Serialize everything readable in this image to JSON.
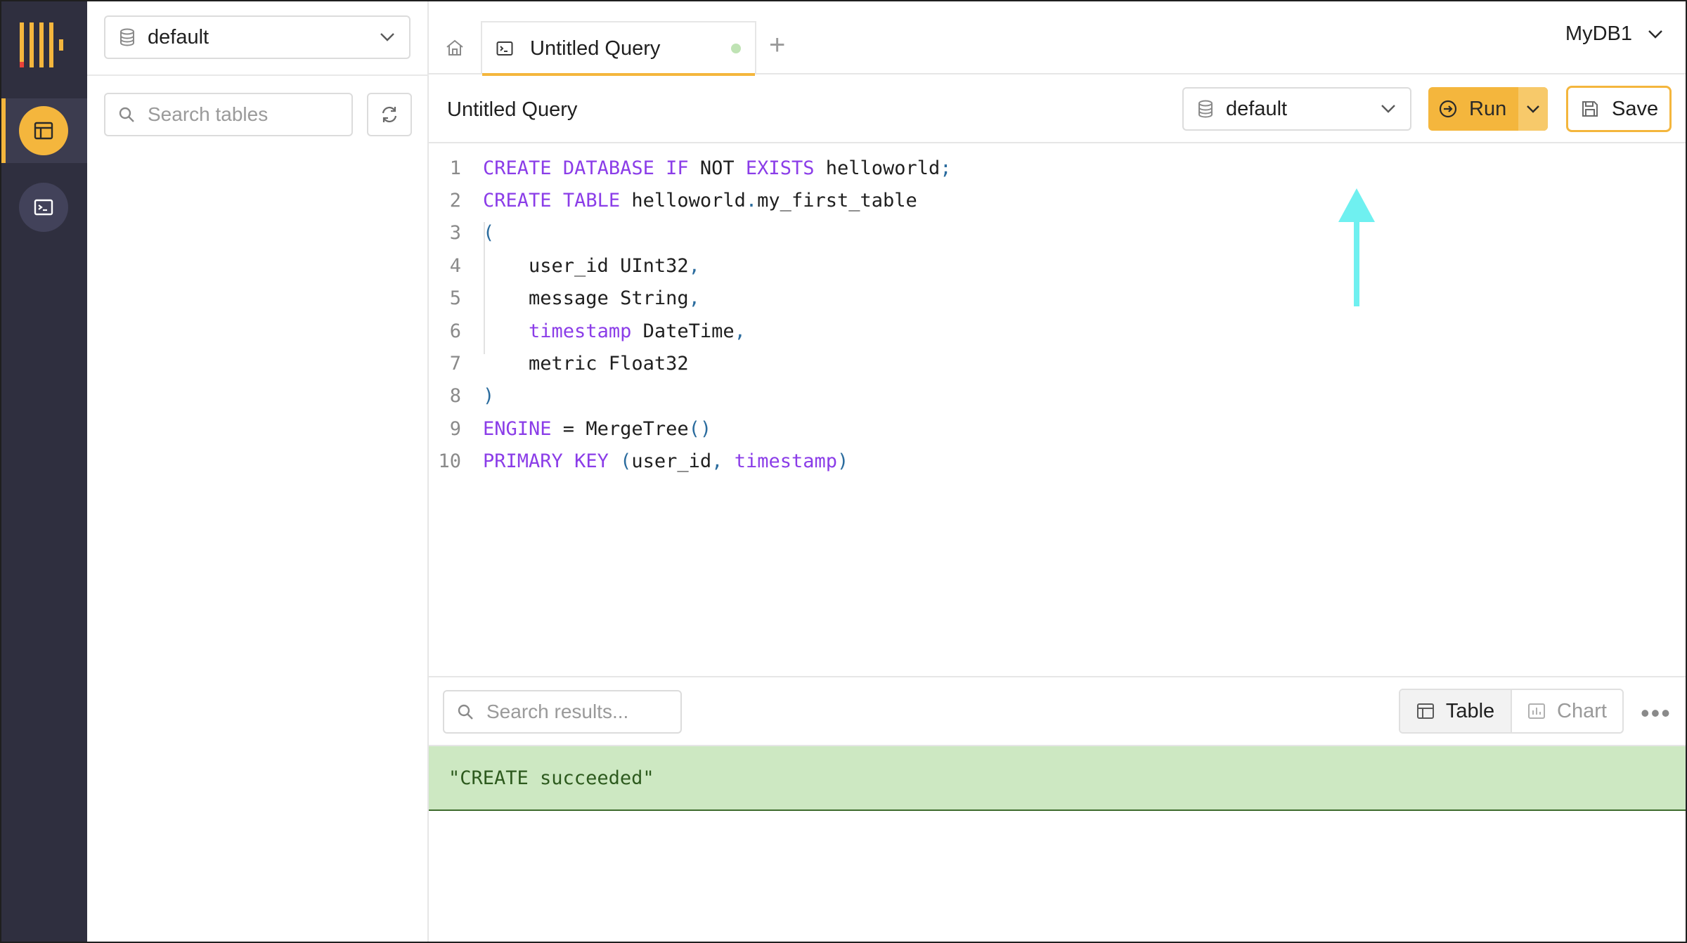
{
  "colors": {
    "nav_bg": "#2f2f3f",
    "accent": "#f4b63d",
    "keyword": "#8b3de8",
    "punct": "#2b6c9e",
    "success_bg": "#cde8c2",
    "success_text": "#2d5a1e",
    "arrow": "#6ff0f0"
  },
  "nav": {
    "logo_icon": "clickhouse-logo",
    "items": [
      {
        "name": "tables",
        "icon": "table-icon",
        "active": true
      },
      {
        "name": "queries",
        "icon": "terminal-icon",
        "active": false
      }
    ]
  },
  "sidebar": {
    "database": "default",
    "search_placeholder": "Search tables",
    "refresh_icon": "refresh-icon"
  },
  "tabs": {
    "home_icon": "home-icon",
    "items": [
      {
        "label": "Untitled Query",
        "icon": "terminal-icon",
        "unsaved": true
      }
    ],
    "add_label": "+",
    "service_name": "MyDB1"
  },
  "toolbar": {
    "query_title": "Untitled Query",
    "database": "default",
    "run_label": "Run",
    "save_label": "Save"
  },
  "editor": {
    "lines": [
      {
        "n": "1",
        "tokens": [
          [
            "kw",
            "CREATE"
          ],
          [
            "t",
            " "
          ],
          [
            "kw",
            "DATABASE"
          ],
          [
            "t",
            " "
          ],
          [
            "kw",
            "IF"
          ],
          [
            "t",
            " NOT "
          ],
          [
            "kw",
            "EXISTS"
          ],
          [
            "t",
            " helloworld"
          ],
          [
            "pn",
            ";"
          ]
        ]
      },
      {
        "n": "2",
        "tokens": [
          [
            "kw",
            "CREATE"
          ],
          [
            "t",
            " "
          ],
          [
            "kw",
            "TABLE"
          ],
          [
            "t",
            " helloworld"
          ],
          [
            "pn",
            "."
          ],
          [
            "t",
            "my_first_table"
          ]
        ]
      },
      {
        "n": "3",
        "tokens": [
          [
            "pn",
            "("
          ]
        ]
      },
      {
        "n": "4",
        "tokens": [
          [
            "t",
            "    user_id UInt32"
          ],
          [
            "pn",
            ","
          ]
        ]
      },
      {
        "n": "5",
        "tokens": [
          [
            "t",
            "    message String"
          ],
          [
            "pn",
            ","
          ]
        ]
      },
      {
        "n": "6",
        "tokens": [
          [
            "t",
            "    "
          ],
          [
            "kw",
            "timestamp"
          ],
          [
            "t",
            " DateTime"
          ],
          [
            "pn",
            ","
          ]
        ]
      },
      {
        "n": "7",
        "tokens": [
          [
            "t",
            "    metric Float32"
          ]
        ]
      },
      {
        "n": "8",
        "tokens": [
          [
            "pn",
            ")"
          ]
        ]
      },
      {
        "n": "9",
        "tokens": [
          [
            "kw",
            "ENGINE"
          ],
          [
            "t",
            " = MergeTree"
          ],
          [
            "pn",
            "()"
          ]
        ]
      },
      {
        "n": "10",
        "tokens": [
          [
            "kw",
            "PRIMARY"
          ],
          [
            "t",
            " "
          ],
          [
            "kw",
            "KEY"
          ],
          [
            "t",
            " "
          ],
          [
            "pn",
            "("
          ],
          [
            "t",
            "user_id"
          ],
          [
            "pn",
            ","
          ],
          [
            "t",
            " "
          ],
          [
            "kw",
            "timestamp"
          ],
          [
            "pn",
            ")"
          ]
        ]
      }
    ]
  },
  "results": {
    "search_placeholder": "Search results...",
    "view_table": "Table",
    "view_chart": "Chart",
    "more": "•••",
    "message": "\"CREATE succeeded\""
  }
}
